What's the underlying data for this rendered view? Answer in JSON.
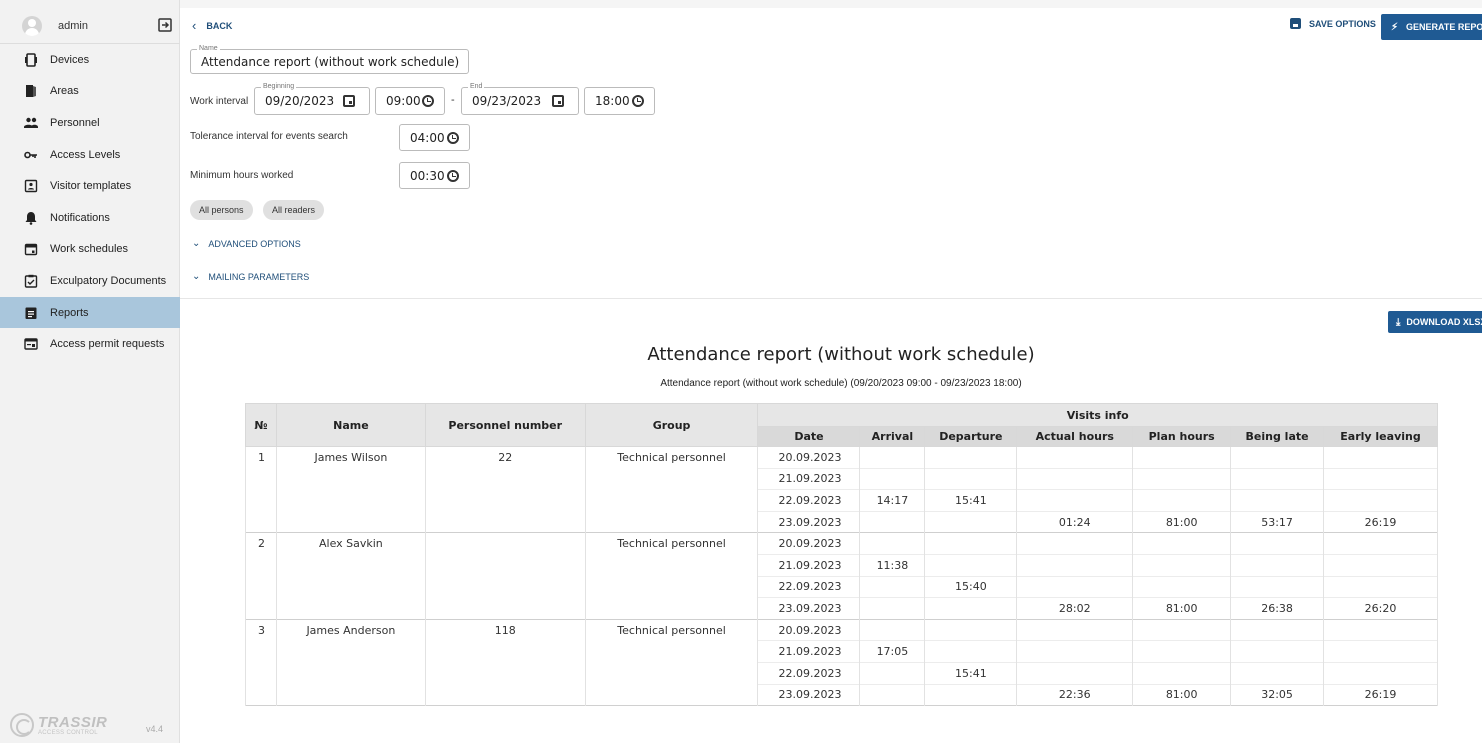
{
  "user": {
    "name": "admin"
  },
  "sidebar": {
    "items": [
      {
        "label": "Devices",
        "icon": "devices-icon"
      },
      {
        "label": "Areas",
        "icon": "areas-icon"
      },
      {
        "label": "Personnel",
        "icon": "people-icon"
      },
      {
        "label": "Access Levels",
        "icon": "key-icon"
      },
      {
        "label": "Visitor templates",
        "icon": "badge-icon"
      },
      {
        "label": "Notifications",
        "icon": "bell-icon"
      },
      {
        "label": "Work schedules",
        "icon": "calendar-icon"
      },
      {
        "label": "Exculpatory Documents",
        "icon": "clipboard-icon"
      },
      {
        "label": "Reports",
        "icon": "report-icon",
        "active": true
      },
      {
        "label": "Access permit requests",
        "icon": "permit-icon"
      }
    ],
    "logo_main": "TRASSIR",
    "logo_sub": "ACCESS CONTROL",
    "version": "v4.4"
  },
  "header": {
    "back_label": "BACK",
    "save_options_label": "SAVE OPTIONS",
    "generate_label": "GENERATE REPORT"
  },
  "form": {
    "name_label": "Name",
    "name_value": "Attendance report (without work schedule)",
    "work_interval_label": "Work interval",
    "beginning_label": "Beginning",
    "beginning_date": "09/20/2023",
    "beginning_time": "09:00",
    "end_label": "End",
    "end_date": "09/23/2023",
    "end_time": "18:00",
    "dash": "-",
    "tolerance_label": "Tolerance interval for events search",
    "tolerance_value": "04:00",
    "min_hours_label": "Minimum hours worked",
    "min_hours_value": "00:30",
    "chip_persons": "All persons",
    "chip_readers": "All readers",
    "advanced_label": "ADVANCED OPTIONS",
    "mailing_label": "MAILING PARAMETERS"
  },
  "report": {
    "download_label": "DOWNLOAD XLSX",
    "title": "Attendance report (without work schedule)",
    "subtitle": "Attendance report (without work schedule) (09/20/2023 09:00 - 09/23/2023 18:00)",
    "columns": {
      "num": "№",
      "name": "Name",
      "personnel_number": "Personnel number",
      "group": "Group",
      "visits_info": "Visits info",
      "date": "Date",
      "arrival": "Arrival",
      "departure": "Departure",
      "actual_hours": "Actual hours",
      "plan_hours": "Plan hours",
      "being_late": "Being late",
      "early_leaving": "Early leaving"
    },
    "rows": [
      {
        "num": "1",
        "name": "James Wilson",
        "personnel_number": "22",
        "group": "Technical personnel",
        "visits": [
          {
            "date": "20.09.2023",
            "arrival": "",
            "departure": "",
            "actual": "",
            "plan": "",
            "late": "",
            "early": ""
          },
          {
            "date": "21.09.2023",
            "arrival": "",
            "departure": "",
            "actual": "",
            "plan": "",
            "late": "",
            "early": ""
          },
          {
            "date": "22.09.2023",
            "arrival": "14:17",
            "departure": "15:41",
            "actual": "",
            "plan": "",
            "late": "",
            "early": ""
          },
          {
            "date": "23.09.2023",
            "arrival": "",
            "departure": "",
            "actual": "01:24",
            "plan": "81:00",
            "late": "53:17",
            "early": "26:19"
          }
        ]
      },
      {
        "num": "2",
        "name": "Alex Savkin",
        "personnel_number": "",
        "group": "Technical personnel",
        "visits": [
          {
            "date": "20.09.2023",
            "arrival": "",
            "departure": "",
            "actual": "",
            "plan": "",
            "late": "",
            "early": ""
          },
          {
            "date": "21.09.2023",
            "arrival": "11:38",
            "departure": "",
            "actual": "",
            "plan": "",
            "late": "",
            "early": ""
          },
          {
            "date": "22.09.2023",
            "arrival": "",
            "departure": "15:40",
            "actual": "",
            "plan": "",
            "late": "",
            "early": ""
          },
          {
            "date": "23.09.2023",
            "arrival": "",
            "departure": "",
            "actual": "28:02",
            "plan": "81:00",
            "late": "26:38",
            "early": "26:20"
          }
        ]
      },
      {
        "num": "3",
        "name": "James Anderson",
        "personnel_number": "118",
        "group": "Technical personnel",
        "visits": [
          {
            "date": "20.09.2023",
            "arrival": "",
            "departure": "",
            "actual": "",
            "plan": "",
            "late": "",
            "early": ""
          },
          {
            "date": "21.09.2023",
            "arrival": "17:05",
            "departure": "",
            "actual": "",
            "plan": "",
            "late": "",
            "early": ""
          },
          {
            "date": "22.09.2023",
            "arrival": "",
            "departure": "15:41",
            "actual": "",
            "plan": "",
            "late": "",
            "early": ""
          },
          {
            "date": "23.09.2023",
            "arrival": "",
            "departure": "",
            "actual": "22:36",
            "plan": "81:00",
            "late": "32:05",
            "early": "26:19"
          }
        ]
      }
    ]
  },
  "colors": {
    "accent": "#1f5a93",
    "sidebar_bg": "#f2f2f2",
    "active_item": "#a9c6dc"
  }
}
